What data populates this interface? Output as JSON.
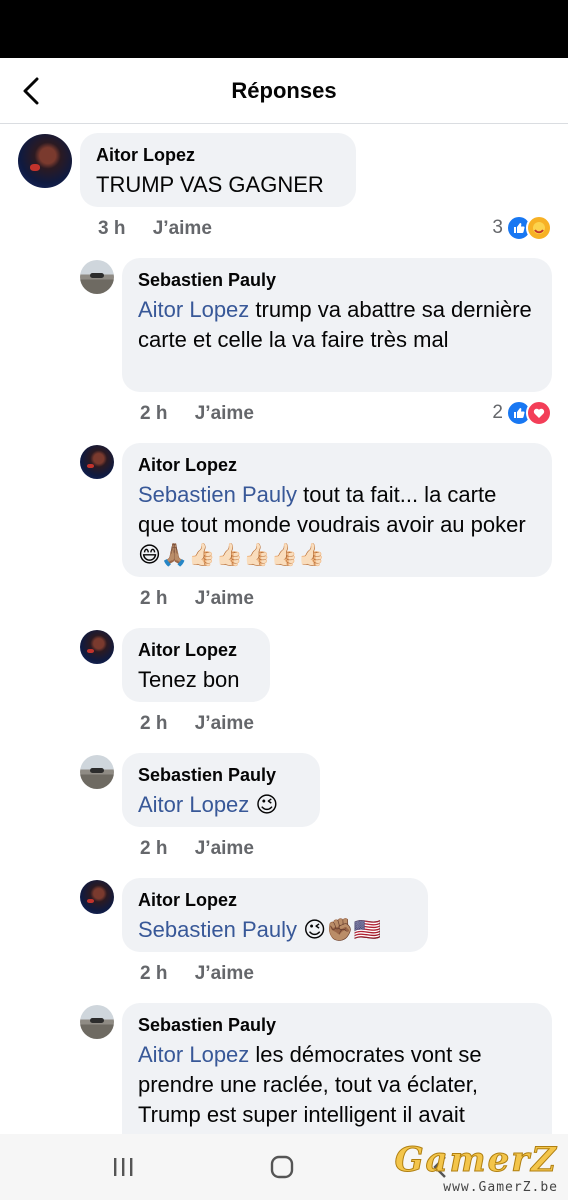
{
  "header": {
    "title": "Réponses"
  },
  "comments": [
    {
      "author": "Aitor Lopez",
      "text": "TRUMP VAS GAGNER",
      "time": "3 h",
      "like_label": "J’aime",
      "reaction_count": "3"
    },
    {
      "author": "Sebastien Pauly",
      "mention": "Aitor Lopez",
      "text": " trump va abattre sa dernière carte et celle la va faire très mal",
      "time": "2 h",
      "like_label": "J’aime",
      "reaction_count": "2"
    },
    {
      "author": "Aitor Lopez",
      "mention": "Sebastien Pauly",
      "text": " tout ta fait... la carte que tout monde voudrais avoir au poker 😄🙏🏽👍🏻👍🏻👍🏻👍🏻👍🏻",
      "time": "2 h",
      "like_label": "J’aime"
    },
    {
      "author": "Aitor Lopez",
      "text": "Tenez bon",
      "time": "2 h",
      "like_label": "J’aime"
    },
    {
      "author": "Sebastien Pauly",
      "mention": "Aitor Lopez",
      "text": " 😉",
      "time": "2 h",
      "like_label": "J’aime"
    },
    {
      "author": "Aitor Lopez",
      "mention": "Sebastien Pauly",
      "text": " 😉✊🏽🇺🇸",
      "time": "2 h",
      "like_label": "J’aime"
    },
    {
      "author": "Sebastien Pauly",
      "mention": "Aitor Lopez",
      "text": " les démocrates vont se prendre une raclée,  tout va éclater, Trump est super intelligent il avait"
    }
  ],
  "icons": {
    "back": "chevron-left-icon",
    "like_reaction": "thumbs-up-icon",
    "love_reaction": "heart-icon",
    "care_reaction": "care-emoji-icon"
  },
  "colors": {
    "mention": "#385898",
    "like_blue": "#1877f2",
    "love_red": "#f33e58",
    "bubble": "#f0f2f5"
  },
  "watermark": {
    "logo": "GamerZ",
    "url": "www.GamerZ.be"
  }
}
